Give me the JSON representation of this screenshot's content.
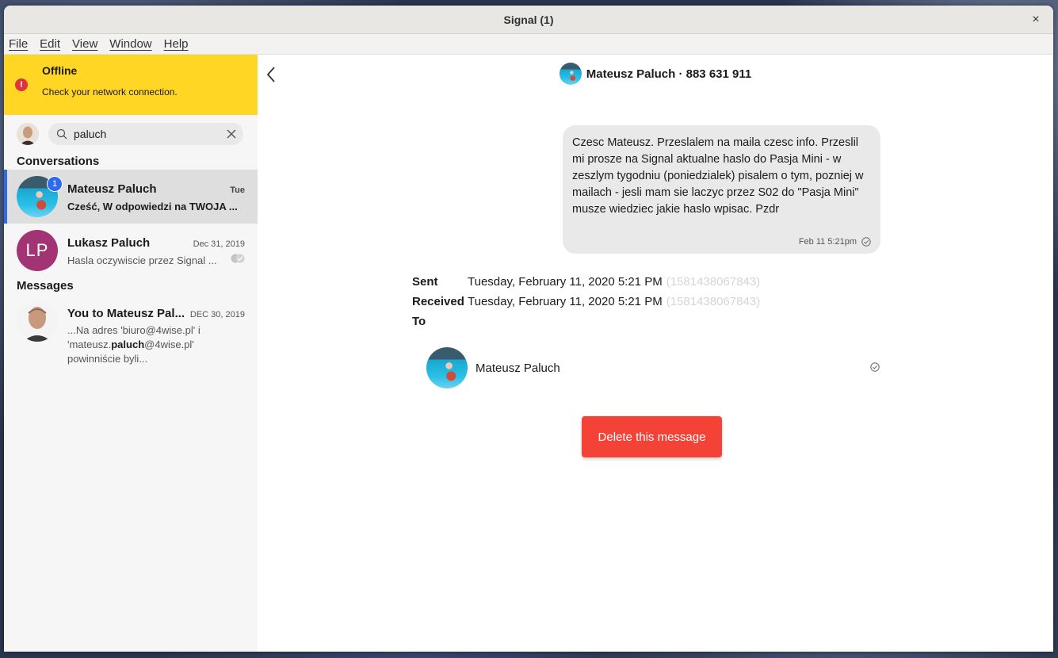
{
  "window": {
    "title": "Signal (1)",
    "close_label": "×"
  },
  "menu": [
    {
      "label": "File"
    },
    {
      "label": "Edit"
    },
    {
      "label": "View"
    },
    {
      "label": "Window"
    },
    {
      "label": "Help"
    }
  ],
  "offline": {
    "title": "Offline",
    "subtitle": "Check your network connection.",
    "icon": "!"
  },
  "search": {
    "value": "paluch",
    "placeholder": "Search"
  },
  "sections": {
    "conversations": "Conversations",
    "messages": "Messages"
  },
  "conversations": [
    {
      "name": "Mateusz Paluch",
      "date": "Tue",
      "snippet": "Cześć, W odpowiedzi na TWOJA ...",
      "badge": "1"
    },
    {
      "name": "Lukasz Paluch",
      "date": "Dec 31, 2019",
      "snippet": "Hasla oczywiscie przez Signal ...",
      "initials": "LP",
      "initials_color": "#a23474"
    }
  ],
  "messages": [
    {
      "name": "You to Mateusz Pal...",
      "date": "DEC 30, 2019",
      "snippet_pre": "...Na adres 'biuro@4wise.pl' i 'mateusz.",
      "snippet_match": "paluch",
      "snippet_post": "@4wise.pl' powinniście byli..."
    }
  ],
  "conversation_header": {
    "title": "Mateusz Paluch · 883 631 911"
  },
  "message": {
    "text": "Czesc Mateusz. Przeslalem na maila czesc info. Przeslil mi prosze na Signal aktualne haslo do Pasja Mini - w zeszlym tygodniu (poniedzialek) pisalem o tym, pozniej w mailach - jesli mam sie laczyc przez S02 do \"Pasja Mini\" musze wiedziec jakie haslo wpisac. Pzdr",
    "time": "Feb 11 5:21pm"
  },
  "details": {
    "sent_label": "Sent",
    "sent_value": "Tuesday, February 11, 2020 5:21 PM",
    "sent_ts": "(1581438067843)",
    "received_label": "Received",
    "received_value": "Tuesday, February 11, 2020 5:21 PM",
    "received_ts": "(1581438067843)",
    "to_label": "To"
  },
  "recipient": {
    "name": "Mateusz Paluch"
  },
  "actions": {
    "delete_label": "Delete this message"
  },
  "colors": {
    "offline_banner": "#ffd624",
    "accent": "#2c6bed",
    "delete": "#f44336",
    "bubble": "#e9e9e9"
  }
}
